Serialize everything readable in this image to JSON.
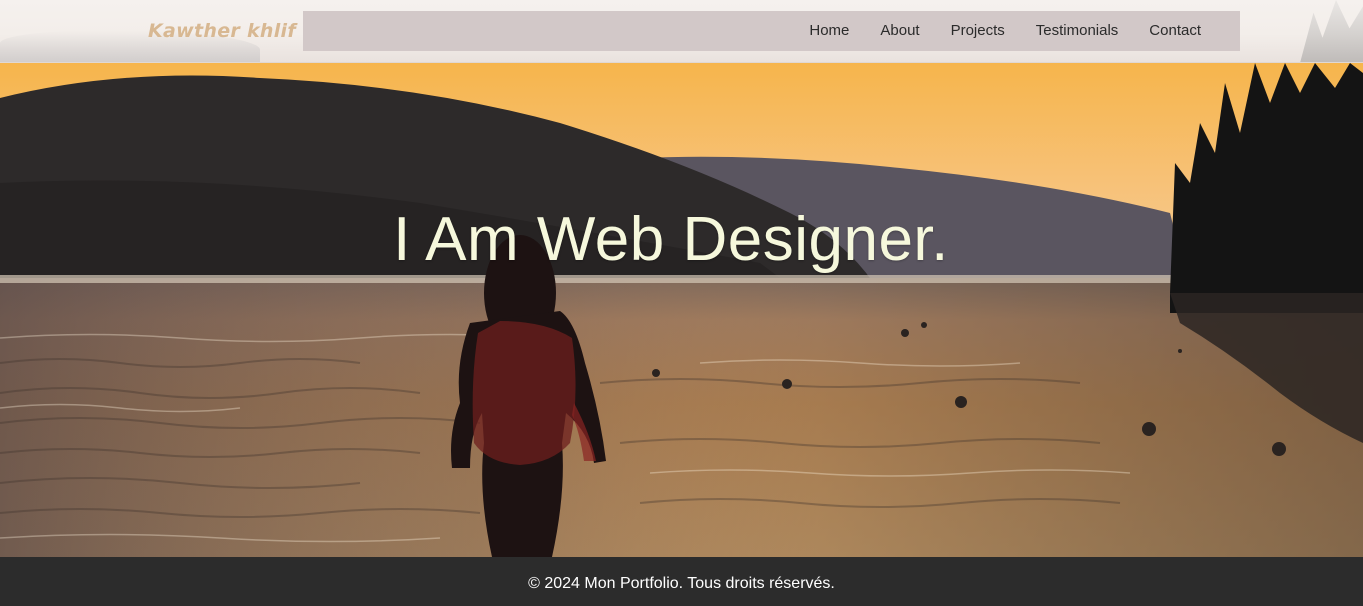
{
  "header": {
    "brand": "Kawther khlif",
    "nav": [
      {
        "label": "Home"
      },
      {
        "label": "About"
      },
      {
        "label": "Projects"
      },
      {
        "label": "Testimonials"
      },
      {
        "label": "Contact"
      }
    ]
  },
  "hero": {
    "title": "I Am Web Designer.",
    "background": "sunset-lake-photo"
  },
  "footer": {
    "copyright": "© 2024 Mon Portfolio. Tous droits réservés."
  },
  "colors": {
    "brand": "#d8b892",
    "navbar_bg": "#d2c8c8",
    "hero_title": "#f6f8dc",
    "footer_bg": "#2c2c2c"
  }
}
